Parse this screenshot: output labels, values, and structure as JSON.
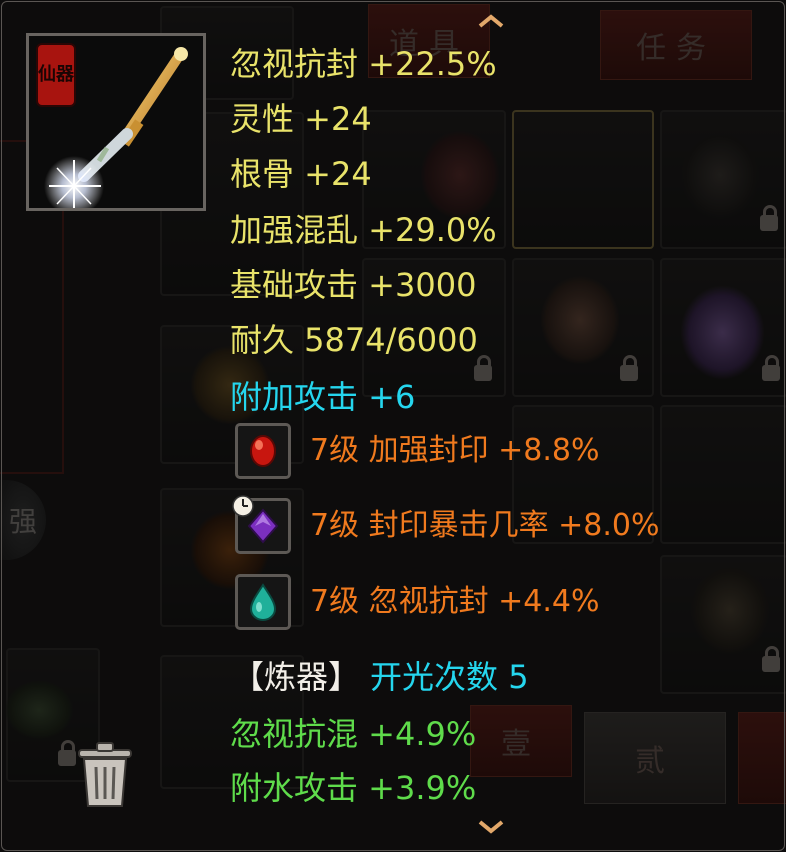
{
  "background": {
    "tabs": [
      "道具",
      "任务",
      "壹",
      "贰"
    ],
    "side_label": "强"
  },
  "item": {
    "grade_badge": "仙器",
    "icon": "golden-sword-icon"
  },
  "stats": [
    {
      "text": "忽视抗封 +22.5%",
      "color": "#e9e36a"
    },
    {
      "text": "灵性 +24",
      "color": "#e9e36a"
    },
    {
      "text": "根骨 +24",
      "color": "#e9e36a"
    },
    {
      "text": "加强混乱 +29.0%",
      "color": "#e9e36a"
    },
    {
      "text": "基础攻击 +3000",
      "color": "#e9e36a"
    },
    {
      "text": "耐久 5874/6000",
      "color": "#e9e36a"
    },
    {
      "text": "附加攻击 +6",
      "color": "#25d6ee"
    }
  ],
  "gems": [
    {
      "icon": "red-gem-icon",
      "text": "7级 加强封印 +8.8%"
    },
    {
      "icon": "purple-gem-icon",
      "text": "7级 封印暴击几率 +8.0%",
      "timed": true
    },
    {
      "icon": "teal-gem-icon",
      "text": "7级 忽视抗封 +4.4%"
    }
  ],
  "refine": {
    "label": "【炼器】",
    "count_text": "开光次数 5"
  },
  "refine_stats": [
    {
      "text": "忽视抗混 +4.9%",
      "color": "#5fdc4b"
    },
    {
      "text": "附水攻击 +3.9%",
      "color": "#5fdc4b"
    }
  ]
}
